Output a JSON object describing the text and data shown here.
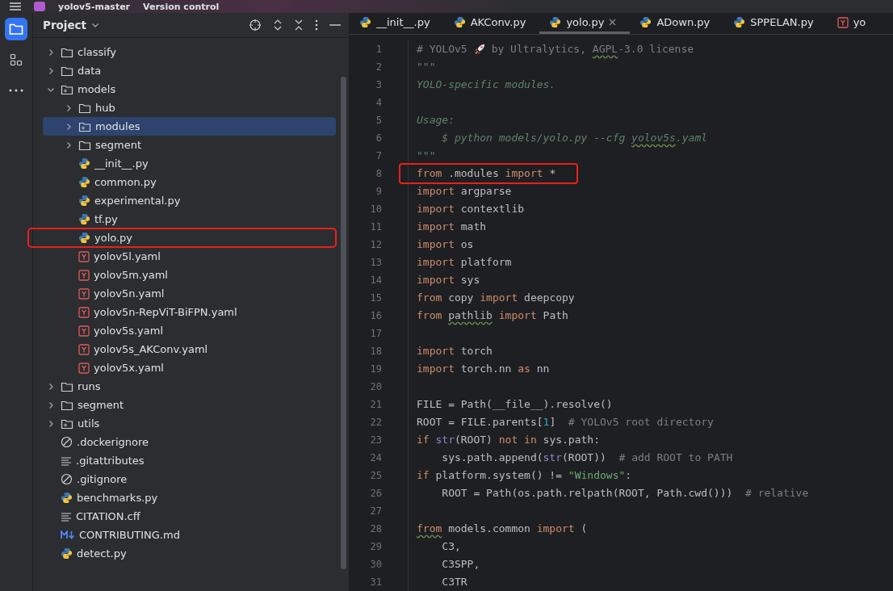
{
  "title_bar": {
    "project": "yolov5-master",
    "vcs": "Version control"
  },
  "tool_strip": [
    {
      "kind": "project",
      "selected": true
    },
    {
      "kind": "structure",
      "selected": false
    },
    {
      "kind": "more",
      "selected": false
    }
  ],
  "project_panel": {
    "title": "Project",
    "tree": [
      {
        "label": "classify",
        "kind": "folder",
        "expanded": false,
        "selected": false,
        "boxed": false
      },
      {
        "label": "data",
        "kind": "folder",
        "expanded": false,
        "selected": false,
        "boxed": false
      },
      {
        "label": "models",
        "kind": "package",
        "expanded": true,
        "selected": false,
        "boxed": false,
        "children": [
          {
            "label": "hub",
            "kind": "folder",
            "expanded": false,
            "selected": false,
            "boxed": false
          },
          {
            "label": "modules",
            "kind": "package",
            "expanded": false,
            "selected": true,
            "boxed": false
          },
          {
            "label": "segment",
            "kind": "folder",
            "expanded": false,
            "selected": false,
            "boxed": false
          },
          {
            "label": "__init__.py",
            "kind": "python",
            "selected": false,
            "boxed": false
          },
          {
            "label": "common.py",
            "kind": "python",
            "selected": false,
            "boxed": false
          },
          {
            "label": "experimental.py",
            "kind": "python",
            "selected": false,
            "boxed": false
          },
          {
            "label": "tf.py",
            "kind": "python",
            "selected": false,
            "boxed": false
          },
          {
            "label": "yolo.py",
            "kind": "python",
            "selected": false,
            "boxed": true
          },
          {
            "label": "yolov5l.yaml",
            "kind": "yaml",
            "selected": false,
            "boxed": false
          },
          {
            "label": "yolov5m.yaml",
            "kind": "yaml",
            "selected": false,
            "boxed": false
          },
          {
            "label": "yolov5n.yaml",
            "kind": "yaml",
            "selected": false,
            "boxed": false
          },
          {
            "label": "yolov5n-RepViT-BiFPN.yaml",
            "kind": "yaml",
            "selected": false,
            "boxed": false
          },
          {
            "label": "yolov5s.yaml",
            "kind": "yaml",
            "selected": false,
            "boxed": false
          },
          {
            "label": "yolov5s_AKConv.yaml",
            "kind": "yaml",
            "selected": false,
            "boxed": false
          },
          {
            "label": "yolov5x.yaml",
            "kind": "yaml",
            "selected": false,
            "boxed": false
          }
        ]
      },
      {
        "label": "runs",
        "kind": "folder",
        "expanded": false,
        "selected": false,
        "boxed": false
      },
      {
        "label": "segment",
        "kind": "folder",
        "expanded": false,
        "selected": false,
        "boxed": false
      },
      {
        "label": "utils",
        "kind": "package",
        "expanded": false,
        "selected": false,
        "boxed": false
      },
      {
        "label": ".dockerignore",
        "kind": "ignore",
        "selected": false,
        "boxed": false
      },
      {
        "label": ".gitattributes",
        "kind": "text",
        "selected": false,
        "boxed": false
      },
      {
        "label": ".gitignore",
        "kind": "ignore",
        "selected": false,
        "boxed": false
      },
      {
        "label": "benchmarks.py",
        "kind": "python",
        "selected": false,
        "boxed": false
      },
      {
        "label": "CITATION.cff",
        "kind": "text",
        "selected": false,
        "boxed": false
      },
      {
        "label": "CONTRIBUTING.md",
        "kind": "markdown",
        "selected": false,
        "boxed": false
      },
      {
        "label": "detect.py",
        "kind": "python",
        "selected": false,
        "boxed": false
      }
    ]
  },
  "tabs": [
    {
      "label": "__init__.py",
      "kind": "python",
      "selected": false
    },
    {
      "label": "AKConv.py",
      "kind": "python",
      "selected": false
    },
    {
      "label": "yolo.py",
      "kind": "python",
      "selected": true
    },
    {
      "label": "ADown.py",
      "kind": "python",
      "selected": false
    },
    {
      "label": "SPPELAN.py",
      "kind": "python",
      "selected": false
    },
    {
      "label": "yo",
      "kind": "yaml",
      "selected": false
    }
  ],
  "code": [
    {
      "n": "1",
      "boxed": false,
      "tokens": [
        {
          "kind": "comment",
          "text": "# YOLOv5"
        },
        {
          "kind": "rocket"
        },
        {
          "kind": "comment",
          "text": "by Ultralytics, "
        },
        {
          "kind": "comment-typo",
          "text": "AGPL"
        },
        {
          "kind": "comment",
          "text": "-3.0 license"
        }
      ]
    },
    {
      "n": "2",
      "boxed": false,
      "tokens": [
        {
          "kind": "doc",
          "text": "\"\"\""
        }
      ]
    },
    {
      "n": "3",
      "boxed": false,
      "tokens": [
        {
          "kind": "doc",
          "text": "YOLO-specific modules."
        }
      ]
    },
    {
      "n": "4",
      "boxed": false
    },
    {
      "n": "5",
      "boxed": false,
      "tokens": [
        {
          "kind": "doc",
          "text": "Usage:"
        }
      ]
    },
    {
      "n": "6",
      "boxed": false,
      "tokens": [
        {
          "kind": "doc",
          "text": "    $ python models/yolo.py --cfg "
        },
        {
          "kind": "doc-typo",
          "text": "yolov5s"
        },
        {
          "kind": "doc",
          "text": ".yaml"
        }
      ]
    },
    {
      "n": "7",
      "boxed": false,
      "tokens": [
        {
          "kind": "doc",
          "text": "\"\"\""
        }
      ]
    },
    {
      "n": "8",
      "boxed": true,
      "tokens": [
        {
          "kind": "kw",
          "text": "from"
        },
        {
          "kind": "plain",
          "text": " .modules "
        },
        {
          "kind": "kw",
          "text": "import"
        },
        {
          "kind": "plain",
          "text": " *"
        }
      ]
    },
    {
      "n": "9",
      "boxed": false,
      "tokens": [
        {
          "kind": "kw",
          "text": "import"
        },
        {
          "kind": "plain",
          "text": " argparse"
        }
      ]
    },
    {
      "n": "10",
      "boxed": false,
      "tokens": [
        {
          "kind": "kw",
          "text": "import"
        },
        {
          "kind": "plain",
          "text": " contextlib"
        }
      ]
    },
    {
      "n": "11",
      "boxed": false,
      "tokens": [
        {
          "kind": "kw",
          "text": "import"
        },
        {
          "kind": "plain",
          "text": " math"
        }
      ]
    },
    {
      "n": "12",
      "boxed": false,
      "tokens": [
        {
          "kind": "kw",
          "text": "import"
        },
        {
          "kind": "plain",
          "text": " os"
        }
      ]
    },
    {
      "n": "13",
      "boxed": false,
      "tokens": [
        {
          "kind": "kw",
          "text": "import"
        },
        {
          "kind": "plain",
          "text": " platform"
        }
      ]
    },
    {
      "n": "14",
      "boxed": false,
      "tokens": [
        {
          "kind": "kw",
          "text": "import"
        },
        {
          "kind": "plain",
          "text": " sys"
        }
      ]
    },
    {
      "n": "15",
      "boxed": false,
      "tokens": [
        {
          "kind": "kw",
          "text": "from"
        },
        {
          "kind": "plain",
          "text": " copy "
        },
        {
          "kind": "kw",
          "text": "import"
        },
        {
          "kind": "plain",
          "text": " deepcopy"
        }
      ]
    },
    {
      "n": "16",
      "boxed": false,
      "tokens": [
        {
          "kind": "kw",
          "text": "from "
        },
        {
          "kind": "plain-typo",
          "text": "pathlib"
        },
        {
          "kind": "kw",
          "text": " import"
        },
        {
          "kind": "plain",
          "text": " Path"
        }
      ]
    },
    {
      "n": "17",
      "boxed": false
    },
    {
      "n": "18",
      "boxed": false,
      "tokens": [
        {
          "kind": "kw",
          "text": "import"
        },
        {
          "kind": "plain",
          "text": " torch"
        }
      ]
    },
    {
      "n": "19",
      "boxed": false,
      "tokens": [
        {
          "kind": "kw",
          "text": "import"
        },
        {
          "kind": "plain",
          "text": " torch.nn "
        },
        {
          "kind": "kw",
          "text": "as"
        },
        {
          "kind": "plain",
          "text": " nn"
        }
      ]
    },
    {
      "n": "20",
      "boxed": false
    },
    {
      "n": "21",
      "boxed": false,
      "tokens": [
        {
          "kind": "plain",
          "text": "FILE = Path(__file__).resolve()"
        }
      ]
    },
    {
      "n": "22",
      "boxed": false,
      "tokens": [
        {
          "kind": "plain",
          "text": "ROOT = FILE.parents["
        },
        {
          "kind": "num",
          "text": "1"
        },
        {
          "kind": "plain",
          "text": "]  "
        },
        {
          "kind": "comment",
          "text": "# YOLOv5 root directory"
        }
      ]
    },
    {
      "n": "23",
      "boxed": false,
      "tokens": [
        {
          "kind": "kw",
          "text": "if "
        },
        {
          "kind": "builtin",
          "text": "str"
        },
        {
          "kind": "plain",
          "text": "(ROOT) "
        },
        {
          "kind": "kw",
          "text": "not in"
        },
        {
          "kind": "plain",
          "text": " sys.path:"
        }
      ]
    },
    {
      "n": "24",
      "boxed": false,
      "tokens": [
        {
          "kind": "plain",
          "text": "    sys.path.append("
        },
        {
          "kind": "builtin",
          "text": "str"
        },
        {
          "kind": "plain",
          "text": "(ROOT))  "
        },
        {
          "kind": "comment",
          "text": "# add ROOT to PATH"
        }
      ]
    },
    {
      "n": "25",
      "boxed": false,
      "tokens": [
        {
          "kind": "kw",
          "text": "if"
        },
        {
          "kind": "plain",
          "text": " platform.system() != "
        },
        {
          "kind": "str",
          "text": "\"Windows\""
        },
        {
          "kind": "plain",
          "text": ":"
        }
      ]
    },
    {
      "n": "26",
      "boxed": false,
      "tokens": [
        {
          "kind": "plain",
          "text": "    ROOT = Path(os.path.relpath(ROOT, Path.cwd()))  "
        },
        {
          "kind": "comment",
          "text": "# relative"
        }
      ]
    },
    {
      "n": "27",
      "boxed": false
    },
    {
      "n": "28",
      "boxed": false,
      "tokens": [
        {
          "kind": "kw-typo",
          "text": "from"
        },
        {
          "kind": "plain",
          "text": " models.common "
        },
        {
          "kind": "kw",
          "text": "import"
        },
        {
          "kind": "plain",
          "text": " ("
        }
      ]
    },
    {
      "n": "29",
      "boxed": false,
      "tokens": [
        {
          "kind": "plain",
          "text": "    C3,"
        }
      ]
    },
    {
      "n": "30",
      "boxed": false,
      "tokens": [
        {
          "kind": "plain",
          "text": "    C3SPP,"
        }
      ]
    },
    {
      "n": "31",
      "boxed": false,
      "tokens": [
        {
          "kind": "plain",
          "text": "    C3TR"
        }
      ]
    }
  ]
}
